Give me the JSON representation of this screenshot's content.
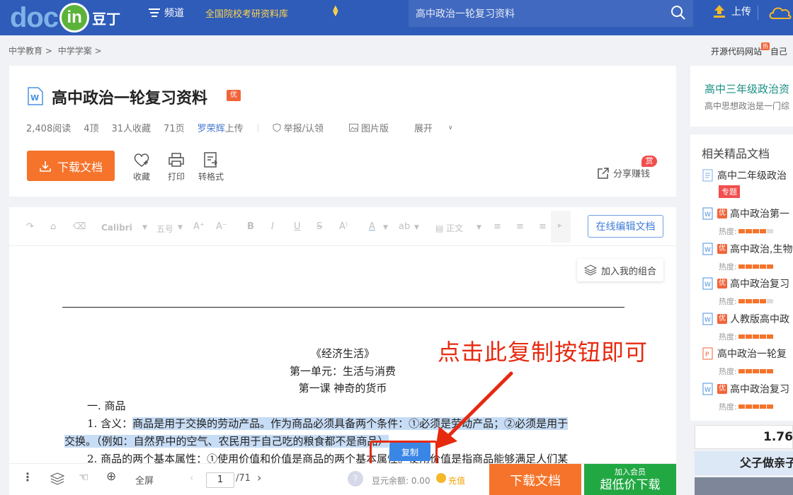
{
  "header": {
    "logo_doc": "doc",
    "logo_in": "in",
    "logo_cn": "豆丁",
    "channel": "频道",
    "kaoyan": "全国院校考研资料库",
    "search_value": "高中政治一轮复习资料",
    "upload": "上传",
    "icons": [
      "menu-icon",
      "search-icon",
      "upload-icon",
      "cloud-icon"
    ]
  },
  "breadcrumb": {
    "items": [
      "中学教育 >",
      "中学学案 >"
    ],
    "right_link": "开源代码网站",
    "right_badge": "热",
    "right_more": "自己"
  },
  "doc": {
    "title": "高中政治一轮复习资料",
    "badge": "优",
    "reads": "2,408阅读",
    "likes": "4顶",
    "favorites": "31人收藏",
    "pages": "71页",
    "uploader": "罗荣辉",
    "uploader_suffix": "上传",
    "report": "举报/认领",
    "image_version": "图片版",
    "expand": "展开"
  },
  "actions": {
    "download": "下载文档",
    "collect": "收藏",
    "print": "打印",
    "convert": "转格式",
    "share": "分享赚钱",
    "share_badge": "赏"
  },
  "toolbar": {
    "font": "Calibri",
    "size": "五号",
    "style": "正文",
    "online_edit": "在线编辑文档",
    "join_combo": "加入我的组合"
  },
  "content": {
    "line1": "《经济生活》",
    "line2": "第一单元：生活与消费",
    "line3": "第一课  神奇的货币",
    "line4": "一. 商品",
    "line5_pre": "1. 含义：",
    "line5_hl": "商品是用于交换的劳动产品。作为商品必须具备两个条件：①必须是劳动产品；②必须是用于",
    "line6_hl": "交换。（例如：自然界中的空气、农民用于自己吃的粮食都不是商品）",
    "line7": "2. 商品的两个基本属性：①使用价值和价值是商品的两个基本属性。使用价值是指商品能够满足人们某",
    "copy_button": "复制",
    "annotation": "点击此复制按钮即可"
  },
  "bottombar": {
    "fullscreen": "全屏",
    "page": "1",
    "total": "/71",
    "balance": "豆元余额: 0.00",
    "recharge": "充值",
    "download": "下载文档",
    "vip_top": "加入会员",
    "vip_bottom": "超低价下载"
  },
  "sidebar": {
    "top_title": "高中三年级政治资",
    "top_desc": "高中思想政治是一门综",
    "list_title": "相关精品文档",
    "items": [
      {
        "title": "高中二年级政治",
        "tag": "专题",
        "type": "doc",
        "badge": "",
        "heat": null
      },
      {
        "title": "高中政治第一",
        "type": "word",
        "badge": "优",
        "heat": "热度:",
        "level": 4
      },
      {
        "title": "高中政治,生物",
        "type": "word",
        "badge": "优",
        "heat": "热度:",
        "level": 5
      },
      {
        "title": "高中政治复习",
        "type": "word",
        "badge": "优",
        "heat": "热度:",
        "level": 4
      },
      {
        "title": "人教版高中政",
        "type": "word",
        "badge": "优",
        "heat": "热度:",
        "level": 5
      },
      {
        "title": "高中政治一轮复",
        "type": "ppt",
        "badge": "",
        "heat": "热度:",
        "level": 5
      },
      {
        "title": "高中政治复习",
        "type": "word",
        "badge": "优",
        "heat": "热度:",
        "level": 5
      }
    ],
    "price": "1.76",
    "ad_text": "父子做亲子"
  }
}
